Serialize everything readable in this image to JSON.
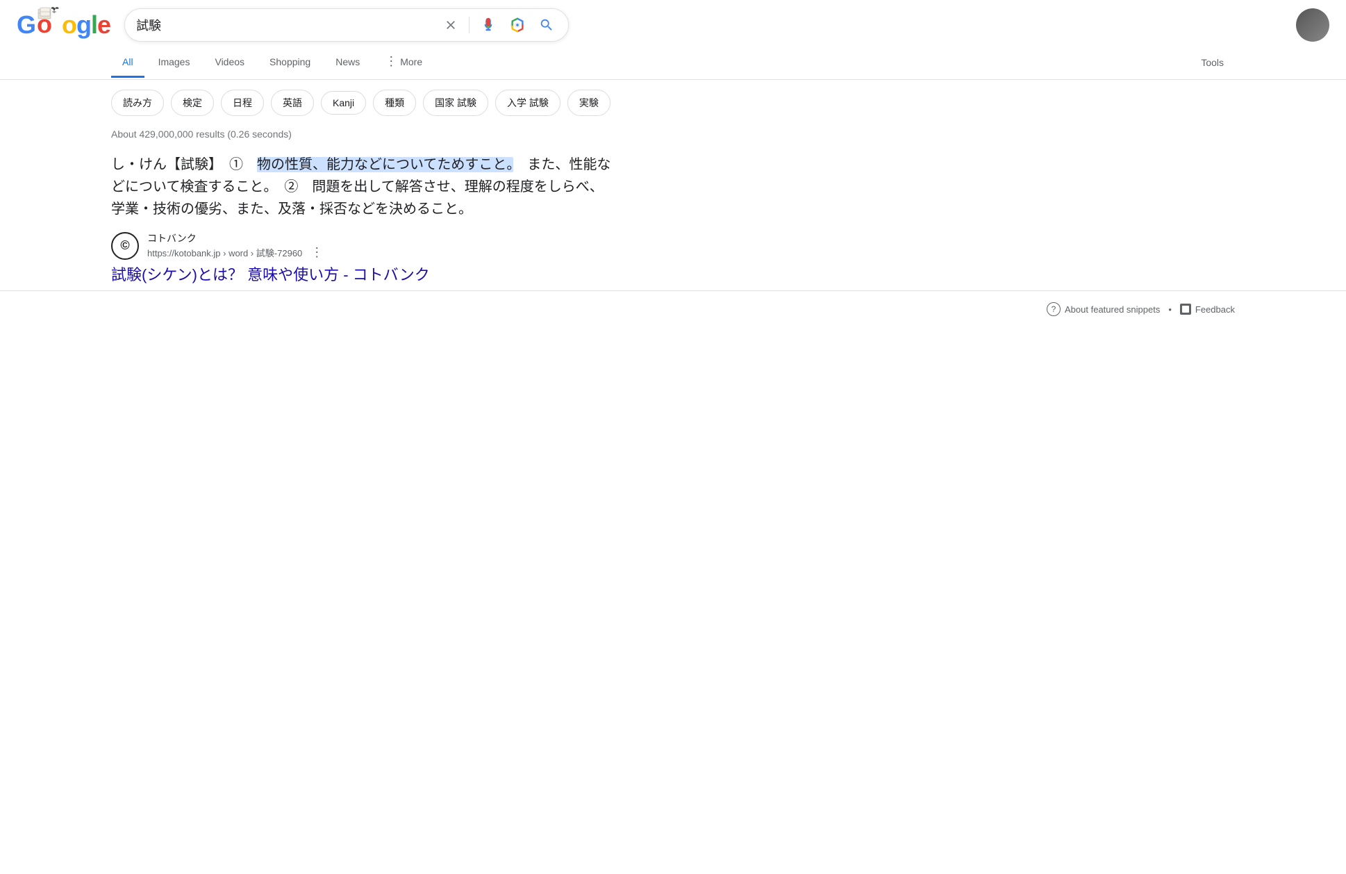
{
  "header": {
    "logo_g": "G",
    "logo_o1": "o",
    "logo_o2": "o",
    "logo_g2": "g",
    "logo_l": "l",
    "logo_e": "e"
  },
  "search": {
    "query": "試験",
    "clear_label": "×",
    "placeholder": "試験"
  },
  "nav": {
    "tabs": [
      {
        "label": "All",
        "active": true
      },
      {
        "label": "Images",
        "active": false
      },
      {
        "label": "Videos",
        "active": false
      },
      {
        "label": "Shopping",
        "active": false
      },
      {
        "label": "News",
        "active": false
      },
      {
        "label": "More",
        "active": false
      }
    ],
    "tools_label": "Tools"
  },
  "chips": [
    {
      "label": "読み方"
    },
    {
      "label": "検定"
    },
    {
      "label": "日程"
    },
    {
      "label": "英語"
    },
    {
      "label": "Kanji"
    },
    {
      "label": "種類"
    },
    {
      "label": "国家 試験"
    },
    {
      "label": "入学 試験"
    },
    {
      "label": "実験"
    }
  ],
  "results": {
    "count": "About 429,000,000 results (0.26 seconds)"
  },
  "featured_snippet": {
    "text_before": "し・けん【試験】　①　",
    "text_highlight": "物の性質、能力などについてためすこと。",
    "text_after": "　また、性能などについて検査すること。　②　問題を出して解答させ、理解の程度をしらべ、学業・技術の優劣、また、及落・採否などを決めること。"
  },
  "source": {
    "icon_text": "©",
    "name": "コトバンク",
    "url": "https://kotobank.jp › word › 試験-72960",
    "more_options_label": "⋮"
  },
  "result": {
    "title": "試験(シケン)とは？ 意味や使い方 - コトバンク",
    "url": "#"
  },
  "feedback": {
    "about_label": "About featured snippets",
    "separator": "•",
    "feedback_label": "Feedback"
  }
}
